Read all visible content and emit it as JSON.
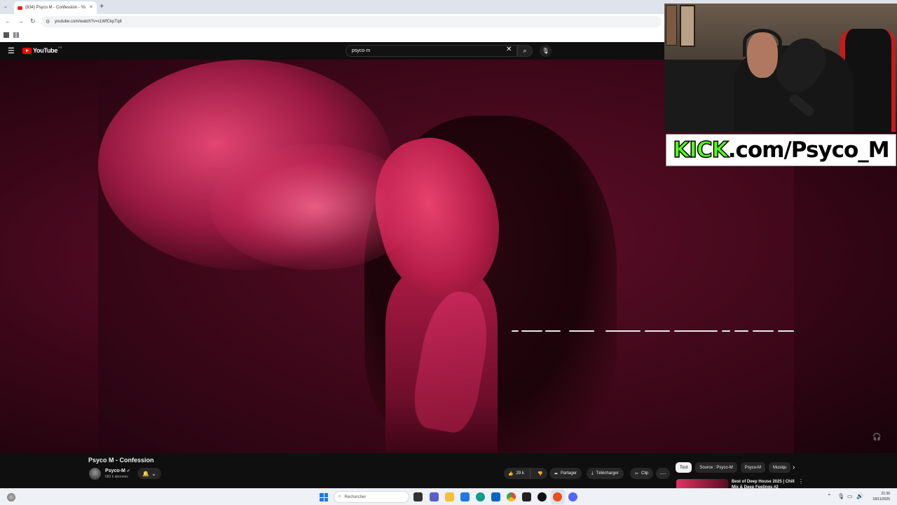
{
  "browser": {
    "tab_title": "(834) Psyco M - Confession - Yo",
    "tab_close": "×",
    "new_tab": "+",
    "tab_list": "⌄",
    "url": "youtube.com/watch?v=cLWfCkpTq8"
  },
  "youtube": {
    "logo_word": "YouTube",
    "logo_region": "FR",
    "search_query": "psyco m",
    "clear": "✕"
  },
  "overlay": {
    "kick_word": "KICK",
    "kick_rest": ".com/Psyco_M"
  },
  "video": {
    "title": "Psyco M - Confession",
    "channel_name": "Psyco-M",
    "channel_subs": "683 k abonnés",
    "likes": "29 k",
    "share_label": "Partager",
    "download_label": "Télécharger",
    "clip_label": "Clip",
    "more_label": "⋯"
  },
  "chips": [
    "Tout",
    "Source : Psyco-M",
    "Psyco-M",
    "Musiqu"
  ],
  "recommendation": {
    "title": "Best of Deep House 2025 | Chill Mix & Deep Feelings #2",
    "more": "⋮"
  },
  "taskbar": {
    "search_placeholder": "Rechercher",
    "time": "21:36",
    "date": "18/11/2025"
  },
  "colors": {
    "youtube_red": "#ff0000",
    "kick_green": "#53fc18",
    "start_blue": "#1f7ae0"
  }
}
